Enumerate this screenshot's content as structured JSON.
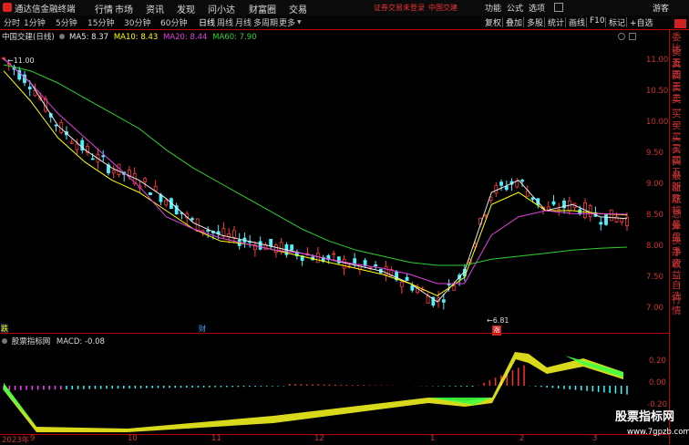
{
  "topbar": {
    "app_name": "通达信金融终端",
    "menu": [
      "行情",
      "市场",
      "资讯",
      "发现",
      "问小达",
      "财富圈",
      "交易"
    ],
    "login_warning": "证券交易未登录",
    "stock_link": "中国交建",
    "right": [
      "功能",
      "公式",
      "选项",
      "游客"
    ]
  },
  "toolbar": {
    "periods": [
      "分时",
      "1分钟",
      "5分钟",
      "15分钟",
      "30分钟",
      "60分钟",
      "日线",
      "周线",
      "月线",
      "多周期",
      "更多"
    ],
    "active_period": "日线",
    "tools": [
      "复权",
      "叠加",
      "多股",
      "统计",
      "画线",
      "F10",
      "标记",
      "+自选"
    ]
  },
  "legend": {
    "name": "中国交建(日线)",
    "ma5": "MA5: 8.37",
    "ma10": "MA10: 8.43",
    "ma20": "MA20: 8.44",
    "ma60": "MA60: 7.90",
    "colors": {
      "ma5": "#e8e8e8",
      "ma10": "#ffff00",
      "ma20": "#e040e0",
      "ma60": "#30d030"
    }
  },
  "price_axis": [
    "11.00",
    "10.50",
    "10.00",
    "9.50",
    "9.00",
    "8.50",
    "8.00",
    "7.50",
    "7.00"
  ],
  "annotations": {
    "high": "11.00",
    "low": "6.81",
    "marker_left": "跌",
    "marker_cai": "财",
    "marker_zhang": "涨"
  },
  "macd": {
    "indicator_name": "股票指标网",
    "label": "MACD: -0.08",
    "axis": [
      "0.20",
      "0.00",
      "-0.20"
    ]
  },
  "x_axis": [
    "2023年",
    "9",
    "10",
    "11",
    "12",
    "1",
    "2",
    "3"
  ],
  "right_panel": [
    "委比",
    "卖五",
    "卖四",
    "卖三",
    "卖二",
    "卖一",
    "买一",
    "买二",
    "买三",
    "买四",
    "买五",
    "最新",
    "涨跌",
    "涨幅",
    "总量",
    "外盘",
    "换手",
    "净资",
    "收益",
    "自选",
    "行情"
  ],
  "watermark": {
    "title": "股票指标网",
    "url": "www.7gpzb.com"
  },
  "chart_data": {
    "type": "line",
    "title": "中国交建(日线)",
    "series": [
      {
        "name": "MA5",
        "values": [
          11.0,
          10.6,
          9.9,
          9.5,
          9.2,
          9.0,
          8.7,
          8.3,
          8.1,
          8.0,
          7.9,
          7.8,
          7.7,
          7.6,
          7.5,
          7.3,
          7.0,
          7.5,
          8.8,
          9.0,
          8.5,
          8.6,
          8.4,
          8.37
        ]
      },
      {
        "name": "MA10",
        "values": [
          10.8,
          10.3,
          9.7,
          9.3,
          9.0,
          8.8,
          8.5,
          8.2,
          8.0,
          7.95,
          7.85,
          7.75,
          7.65,
          7.55,
          7.45,
          7.3,
          7.1,
          7.4,
          8.6,
          8.8,
          8.5,
          8.5,
          8.45,
          8.43
        ]
      },
      {
        "name": "MA20",
        "values": [
          11.0,
          10.6,
          10.1,
          9.7,
          9.3,
          8.9,
          8.4,
          8.2,
          8.05,
          7.95,
          7.85,
          7.8,
          7.7,
          7.62,
          7.55,
          7.45,
          7.3,
          7.3,
          8.1,
          8.4,
          8.5,
          8.45,
          8.45,
          8.44
        ]
      },
      {
        "name": "MA60",
        "values": [
          10.9,
          10.8,
          10.6,
          10.35,
          10.1,
          9.85,
          9.5,
          9.2,
          8.95,
          8.7,
          8.45,
          8.2,
          8.0,
          7.85,
          7.75,
          7.65,
          7.6,
          7.6,
          7.7,
          7.75,
          7.8,
          7.85,
          7.88,
          7.9
        ]
      }
    ],
    "ylim": [
      6.7,
      11.2
    ],
    "low_value": 6.81,
    "high_value": 11.0
  }
}
